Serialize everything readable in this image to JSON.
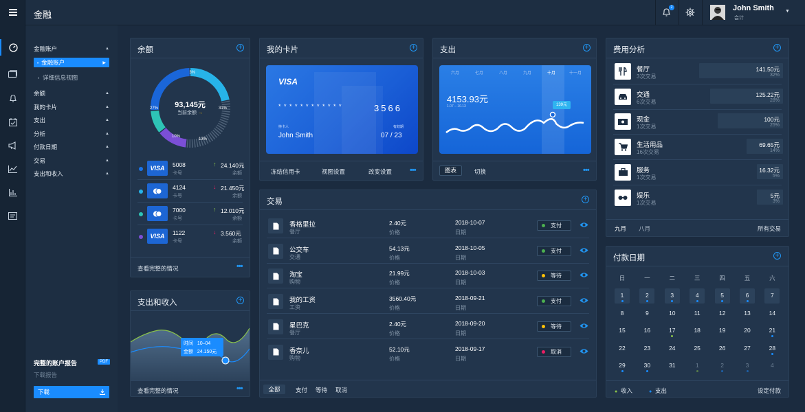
{
  "app": {
    "title": "金融"
  },
  "user": {
    "name": "John Smith",
    "role": "会计",
    "notification_count": "2"
  },
  "sidebar": {
    "groups": [
      {
        "label": "金融账户"
      },
      {
        "label": "余额"
      },
      {
        "label": "我的卡片"
      },
      {
        "label": "支出"
      },
      {
        "label": "分析"
      },
      {
        "label": "付款日期"
      },
      {
        "label": "交易"
      },
      {
        "label": "支出和收入"
      }
    ],
    "sub_items": [
      {
        "label": "金融账户"
      },
      {
        "label": "详细信息视图"
      }
    ],
    "report": {
      "title": "完整的账户报告",
      "badge": "PDF",
      "sub": "下载报告",
      "button": "下载"
    }
  },
  "balance": {
    "title": "余额",
    "total": "93,145元",
    "total_label": "当前余额",
    "donut": [
      {
        "label": "23%",
        "value": 23,
        "color": "#27b3e8"
      },
      {
        "label": "31%",
        "value": 31,
        "color": "#34495e"
      },
      {
        "label": "13%",
        "value": 13,
        "color": "#7b4fd6"
      },
      {
        "label": "10%",
        "value": 10,
        "color": "#2ec4b6"
      },
      {
        "label": "27%",
        "value": 27,
        "color": "#1a66d9"
      }
    ],
    "cards": [
      {
        "brand": "VISA",
        "num": "5008",
        "sub": "卡号",
        "amount": "24.140元",
        "amount_sub": "余额",
        "trend": "up",
        "dot": "#1a73e8"
      },
      {
        "brand": "MC",
        "num": "4124",
        "sub": "卡号",
        "amount": "21.450元",
        "amount_sub": "余额",
        "trend": "down",
        "dot": "#27b3e8"
      },
      {
        "brand": "MC",
        "num": "7000",
        "sub": "卡号",
        "amount": "12.010元",
        "amount_sub": "余额",
        "trend": "up",
        "dot": "#2ec4b6"
      },
      {
        "brand": "VISA",
        "num": "1122",
        "sub": "卡号",
        "amount": "3.560元",
        "amount_sub": "余额",
        "trend": "down",
        "dot": "#7b4fd6"
      }
    ],
    "footer": "查看完整的情况"
  },
  "mycard": {
    "title": "我的卡片",
    "brand": "VISA",
    "masked": "* * * *   * * * *   * * * *",
    "last4": "3566",
    "holder_label": "持卡人",
    "holder": "John Smith",
    "expiry_label": "有效期",
    "expiry": "07 / 23",
    "actions": [
      "冻结信用卡",
      "视图设置",
      "改变设置"
    ]
  },
  "spending": {
    "title": "支出",
    "months": [
      "六月",
      "七月",
      "八月",
      "九月",
      "十月",
      "十一月"
    ],
    "active_month": "十月",
    "amount": "4153.93元",
    "range": "1.07 – 10.13",
    "marker": "139元",
    "tabs": [
      "图表",
      "切换"
    ]
  },
  "income": {
    "title": "支出和收入",
    "tooltip": {
      "time_label": "时间",
      "time": "10–04",
      "amount_label": "金额",
      "amount": "24.150元"
    },
    "footer": "查看完整的情况"
  },
  "transactions": {
    "title": "交易",
    "rows": [
      {
        "name": "香格里拉",
        "cat": "餐厅",
        "amount": "2.40元",
        "amount_label": "价格",
        "date": "2018-10-07",
        "date_label": "日期",
        "status": "支付",
        "status_color": "#4caf50"
      },
      {
        "name": "公交车",
        "cat": "交通",
        "amount": "54.13元",
        "amount_label": "价格",
        "date": "2018-10-05",
        "date_label": "日期",
        "status": "支付",
        "status_color": "#4caf50"
      },
      {
        "name": "淘宝",
        "cat": "购物",
        "amount": "21.99元",
        "amount_label": "价格",
        "date": "2018-10-03",
        "date_label": "日期",
        "status": "等待",
        "status_color": "#ffc107"
      },
      {
        "name": "我的工资",
        "cat": "工资",
        "amount": "3560.40元",
        "amount_label": "价格",
        "date": "2018-09-21",
        "date_label": "日期",
        "status": "支付",
        "status_color": "#4caf50"
      },
      {
        "name": "星巴克",
        "cat": "餐厅",
        "amount": "2.40元",
        "amount_label": "价格",
        "date": "2018-09-20",
        "date_label": "日期",
        "status": "等待",
        "status_color": "#ffc107"
      },
      {
        "name": "香奈儿",
        "cat": "购物",
        "amount": "52.10元",
        "amount_label": "价格",
        "date": "2018-09-17",
        "date_label": "日期",
        "status": "取消",
        "status_color": "#e91e63"
      }
    ],
    "filters": [
      "全部",
      "支付",
      "等待",
      "取消"
    ]
  },
  "expense": {
    "title": "费用分析",
    "rows": [
      {
        "name": "餐厅",
        "count": "3次交易",
        "amount": "141.50元",
        "pct": "32%",
        "share": 0.32,
        "icon": "utensils-icon"
      },
      {
        "name": "交通",
        "count": "6次交易",
        "amount": "125.22元",
        "pct": "28%",
        "share": 0.28,
        "icon": "car-icon"
      },
      {
        "name": "现金",
        "count": "1次交易",
        "amount": "100元",
        "pct": "25%",
        "share": 0.25,
        "icon": "cash-icon"
      },
      {
        "name": "生活用品",
        "count": "16次交易",
        "amount": "69.65元",
        "pct": "14%",
        "share": 0.14,
        "icon": "cart-icon"
      },
      {
        "name": "服务",
        "count": "1次交易",
        "amount": "16.32元",
        "pct": "5%",
        "share": 0.05,
        "icon": "briefcase-icon"
      },
      {
        "name": "娱乐",
        "count": "1次交易",
        "amount": "5元",
        "pct": "3%",
        "share": 0.03,
        "icon": "glasses-icon"
      }
    ],
    "tabs": [
      "九月",
      "八月"
    ],
    "link": "所有交易"
  },
  "calendar": {
    "title": "付款日期",
    "weekdays": [
      "日",
      "一",
      "二",
      "三",
      "四",
      "五",
      "六"
    ],
    "weeks": [
      [
        "1",
        "2",
        "3",
        "4",
        "5",
        "6",
        "7"
      ],
      [
        "8",
        "9",
        "10",
        "11",
        "12",
        "13",
        "14"
      ],
      [
        "15",
        "16",
        "17",
        "18",
        "19",
        "20",
        "21"
      ],
      [
        "22",
        "23",
        "24",
        "25",
        "26",
        "27",
        "28"
      ],
      [
        "29",
        "30",
        "31",
        "1",
        "2",
        "3",
        "4"
      ]
    ],
    "legend": {
      "income": "收入",
      "expense": "支出",
      "link": "设定付款"
    }
  }
}
